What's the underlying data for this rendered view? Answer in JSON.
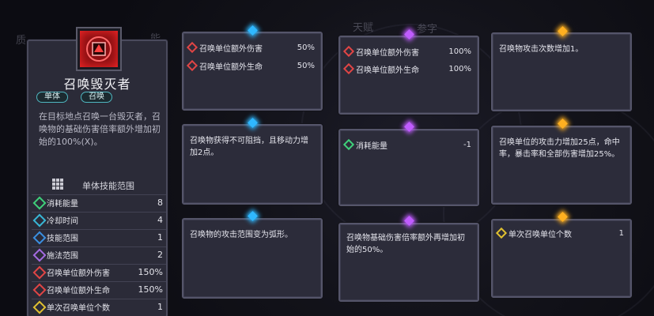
{
  "skill": {
    "name": "召唤毁灭者",
    "tags": [
      "单体",
      "召唤"
    ],
    "description": "在目标地点召唤一台毁灭者，召唤物的基础伤害倍率额外增加初始的100%(X)。",
    "range_label": "单体技能范围",
    "stats": [
      {
        "label": "消耗能量",
        "value": "8",
        "icon": "energy-icon",
        "color": "#3fd07a"
      },
      {
        "label": "冷却时间",
        "value": "4",
        "icon": "cooldown-icon",
        "color": "#38b6d6"
      },
      {
        "label": "技能范围",
        "value": "1",
        "icon": "range-icon",
        "color": "#3a8fe0"
      },
      {
        "label": "施法范围",
        "value": "2",
        "icon": "cast-range-icon",
        "color": "#a46be0"
      },
      {
        "label": "召唤单位额外伤害",
        "value": "150%",
        "icon": "summon-damage-icon",
        "color": "#e04545"
      },
      {
        "label": "召唤单位额外生命",
        "value": "150%",
        "icon": "summon-health-icon",
        "color": "#e04545"
      },
      {
        "label": "单次召唤单位个数",
        "value": "1",
        "icon": "summon-count-icon",
        "color": "#e0c030"
      }
    ]
  },
  "background": {
    "labels": [
      "质",
      "能",
      "天赋",
      "参字"
    ]
  },
  "cards": {
    "c1": {
      "rows": [
        {
          "label": "召唤单位额外伤害",
          "value": "50%",
          "icon": "summon-damage-icon",
          "color": "#e04545"
        },
        {
          "label": "召唤单位额外生命",
          "value": "50%",
          "icon": "summon-health-icon",
          "color": "#e04545"
        }
      ]
    },
    "c2": {
      "text": "召唤物获得不可阻挡，且移动力增加2点。"
    },
    "c3": {
      "text": "召唤物的攻击范围变为弧形。"
    },
    "c4": {
      "rows": [
        {
          "label": "召唤单位额外伤害",
          "value": "100%",
          "icon": "summon-damage-icon",
          "color": "#e04545"
        },
        {
          "label": "召唤单位额外生命",
          "value": "100%",
          "icon": "summon-health-icon",
          "color": "#e04545"
        }
      ]
    },
    "c5": {
      "rows": [
        {
          "label": "消耗能量",
          "value": "-1",
          "icon": "energy-icon",
          "color": "#3fd07a"
        }
      ]
    },
    "c6": {
      "text": "召唤物基础伤害倍率额外再增加初始的50%。"
    },
    "c7": {
      "text": "召唤物攻击次数增加1。"
    },
    "c8": {
      "text": "召唤单位的攻击力增加25点，命中率，暴击率和全部伤害增加25%。"
    },
    "c9": {
      "rows": [
        {
          "label": "单次召唤单位个数",
          "value": "1",
          "icon": "summon-count-icon",
          "color": "#e0c030"
        }
      ]
    }
  },
  "colors": {
    "gem_blue": "#2fb8ff",
    "gem_purple": "#c05cff",
    "gem_gold": "#ffb020"
  }
}
